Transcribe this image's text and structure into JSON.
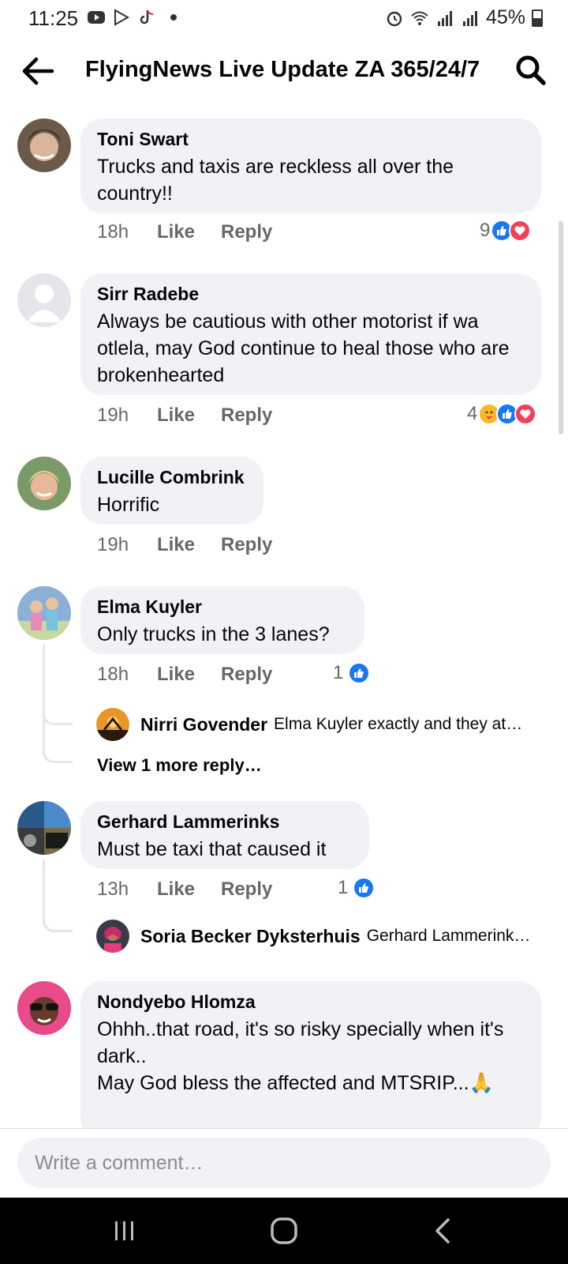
{
  "status_bar": {
    "time": "11:25",
    "battery": "45%"
  },
  "header": {
    "title": "FlyingNews Live Update ZA 365/24/7"
  },
  "comments": [
    {
      "name": "Toni Swart",
      "text": "Trucks and taxis are reckless all over the country!!",
      "time": "18h",
      "like_label": "Like",
      "reply_label": "Reply",
      "reaction_count": "9",
      "reactions": [
        "like",
        "love"
      ]
    },
    {
      "name": "Sirr Radebe",
      "text": "Always be cautious with other motorist if wa otlela, may God continue to heal those who are brokenhearted",
      "time": "19h",
      "like_label": "Like",
      "reply_label": "Reply",
      "reaction_count": "4",
      "reactions": [
        "care",
        "like",
        "love"
      ]
    },
    {
      "name": "Lucille Combrink",
      "text": "Horrific",
      "time": "19h",
      "like_label": "Like",
      "reply_label": "Reply"
    },
    {
      "name": "Elma Kuyler",
      "text": "Only trucks in the 3 lanes?",
      "time": "18h",
      "like_label": "Like",
      "reply_label": "Reply",
      "reaction_count": "1",
      "reactions": [
        "like"
      ],
      "replies": [
        {
          "name": "Nirri Govender",
          "preview": "Elma Kuyler exactly  and they at…"
        }
      ],
      "more_replies_label": "View 1 more reply…"
    },
    {
      "name": "Gerhard Lammerinks",
      "text": "Must be taxi that caused it",
      "time": "13h",
      "like_label": "Like",
      "reply_label": "Reply",
      "reaction_count": "1",
      "reactions": [
        "like"
      ],
      "replies": [
        {
          "name": "Soria Becker Dyksterhuis",
          "preview": "Gerhard Lammerink…"
        }
      ]
    },
    {
      "name": "Nondyebo Hlomza",
      "text_line1": "Ohhh..that road, it's so risky specially when it's dark..",
      "text_line2": "May God bless the affected and MTSRIP...🙏"
    }
  ],
  "composer": {
    "placeholder": "Write a comment…"
  },
  "colors": {
    "bubble": "#f0f2f5",
    "like_blue": "#1877f2",
    "love_red": "#f33e58",
    "secondary_text": "#65676b"
  },
  "icons": [
    "back-arrow-icon",
    "search-icon",
    "like-icon",
    "love-icon",
    "care-icon",
    "nav-recents-icon",
    "nav-home-icon",
    "nav-back-icon"
  ]
}
